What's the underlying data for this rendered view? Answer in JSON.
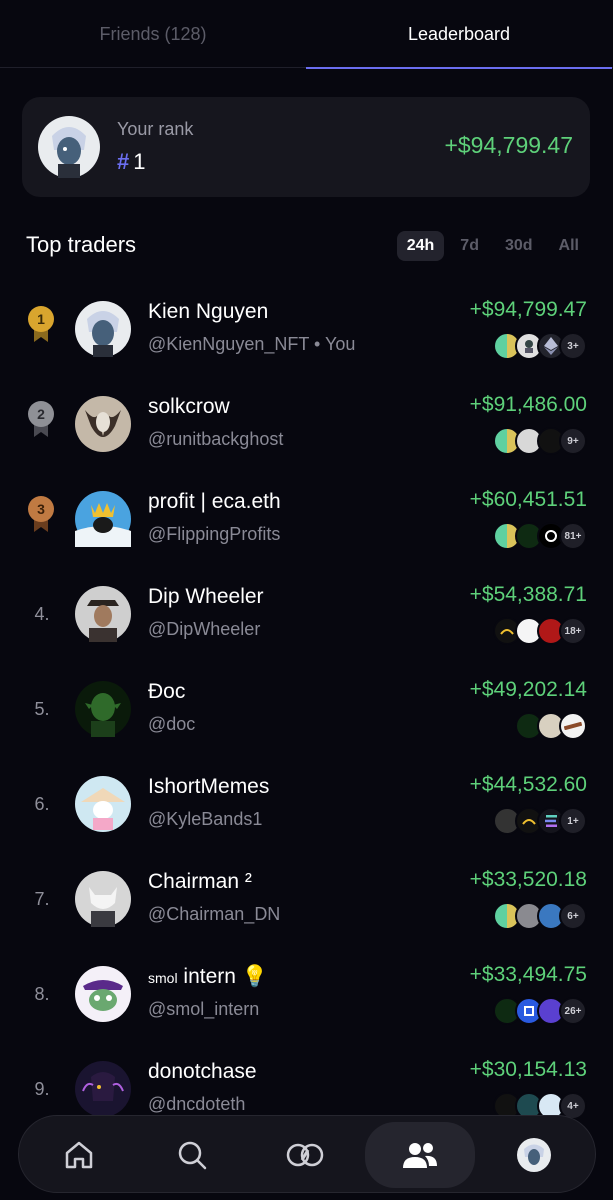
{
  "tabs": [
    {
      "label": "Friends (128)",
      "active": false
    },
    {
      "label": "Leaderboard",
      "active": true
    }
  ],
  "your_rank": {
    "label": "Your rank",
    "hash": "#",
    "rank": "1",
    "pnl": "+$94,799.47"
  },
  "top_traders": {
    "title": "Top traders",
    "periods": [
      {
        "label": "24h",
        "active": true
      },
      {
        "label": "7d",
        "active": false
      },
      {
        "label": "30d",
        "active": false
      },
      {
        "label": "All",
        "active": false
      }
    ]
  },
  "traders": [
    {
      "rank": "1",
      "medal": "gold",
      "name": "Kien Nguyen",
      "handle": "@KienNguyen_NFT • You",
      "pnl": "+$94,799.47",
      "more": "3+"
    },
    {
      "rank": "2",
      "medal": "silver",
      "name": "solkcrow",
      "handle": "@runitbackghost",
      "pnl": "+$91,486.00",
      "more": "9+"
    },
    {
      "rank": "3",
      "medal": "bronze",
      "name": "profit | eca.eth",
      "handle": "@FlippingProfits",
      "pnl": "+$60,451.51",
      "more": "81+"
    },
    {
      "rank": "4.",
      "medal": "",
      "name": "Dip Wheeler",
      "handle": "@DipWheeler",
      "pnl": "+$54,388.71",
      "more": "18+"
    },
    {
      "rank": "5.",
      "medal": "",
      "name": "Đoc",
      "handle": "@doc",
      "pnl": "+$49,202.14",
      "more": ""
    },
    {
      "rank": "6.",
      "medal": "",
      "name": "IshortMemes",
      "handle": "@KyleBands1",
      "pnl": "+$44,532.60",
      "more": "1+"
    },
    {
      "rank": "7.",
      "medal": "",
      "name": "Chairman ²",
      "handle": "@Chairman_DN",
      "pnl": "+$33,520.18",
      "more": "6+"
    },
    {
      "rank": "8.",
      "medal": "",
      "name_small": "smol",
      "name": "intern 💡",
      "handle": "@smol_intern",
      "pnl": "+$33,494.75",
      "more": "26+"
    },
    {
      "rank": "9.",
      "medal": "",
      "name": "donotchase",
      "handle": "@dncdoteth",
      "pnl": "+$30,154.13",
      "more": "4+"
    }
  ],
  "nav": [
    "home-icon",
    "search-icon",
    "swap-icon",
    "friends-icon",
    "profile-avatar"
  ],
  "colors": {
    "accent": "#6b6ef0",
    "positive": "#5ed17a",
    "background": "#07070f",
    "card": "#16161e"
  }
}
